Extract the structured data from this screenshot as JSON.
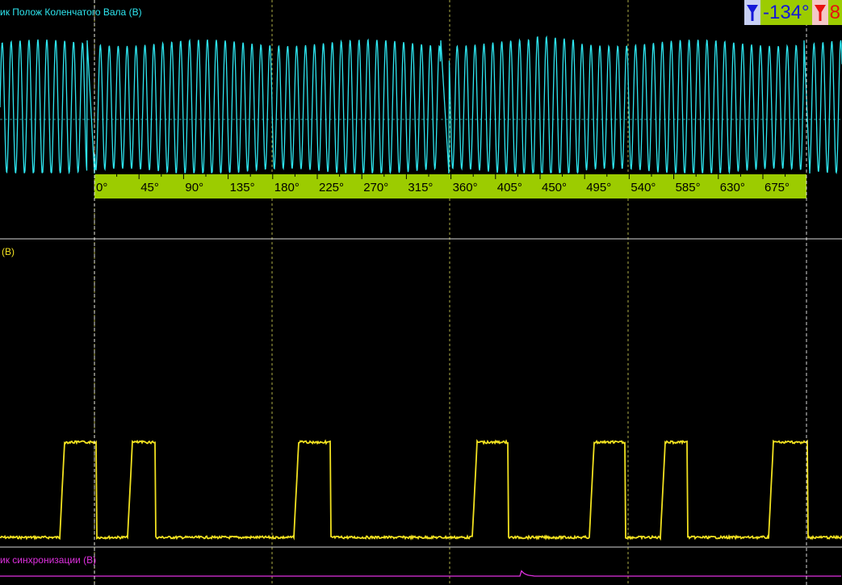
{
  "channels": [
    {
      "label": "ик Полож Коленчатого Вала (В)",
      "color": "#2ee6f0"
    },
    {
      "label": "(В)",
      "color": "#f0e020"
    },
    {
      "label": "ик синхронизации (В)",
      "color": "#e030e0"
    }
  ],
  "cursor_readout": {
    "cursor_a_icon": "funnel-down-blue-icon",
    "cursor_a_value": "-134°",
    "cursor_b_icon": "funnel-down-red-icon",
    "cursor_b_value": "8"
  },
  "angle_ruler": {
    "background": "#9ccc00",
    "ticks": [
      "0°",
      "45°",
      "90°",
      "135°",
      "180°",
      "225°",
      "270°",
      "315°",
      "360°",
      "405°",
      "450°",
      "495°",
      "540°",
      "585°",
      "630°",
      "675°"
    ]
  },
  "colors": {
    "crank": "#2ee6f0",
    "injector": "#f0e020",
    "sync": "#e030e0",
    "grid": "#e8e860",
    "separator": "#d8d8d8"
  }
}
